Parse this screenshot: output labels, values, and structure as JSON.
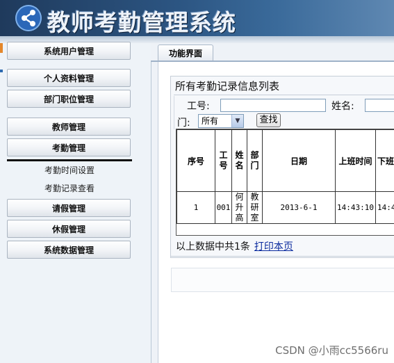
{
  "app": {
    "title": "教师考勤管理系统"
  },
  "sidebar": {
    "items": [
      {
        "label": "系统用户管理"
      },
      {
        "label": "个人资料管理"
      },
      {
        "label": "部门职位管理"
      },
      {
        "label": "教师管理"
      },
      {
        "label": "考勤管理"
      },
      {
        "label": "请假管理"
      },
      {
        "label": "休假管理"
      },
      {
        "label": "系统数据管理"
      }
    ],
    "submenu": [
      {
        "label": "考勤时间设置"
      },
      {
        "label": "考勤记录查看"
      }
    ]
  },
  "tabs": [
    {
      "label": "功能界面"
    }
  ],
  "panel": {
    "title": "所有考勤记录信息列表",
    "search": {
      "emp_no_label": "工号:",
      "name_label": "姓名:",
      "dept_label": "门:",
      "dept_selected": "所有",
      "find_button": "查找",
      "emp_no_value": "",
      "name_value": ""
    },
    "table": {
      "headers": [
        "序号",
        "工号",
        "姓名",
        "部门",
        "日期",
        "上班时间",
        "下班"
      ],
      "rows": [
        [
          "1",
          "001",
          "何升高",
          "教研室",
          "2013-6-1",
          "14:43:10",
          "14:4"
        ]
      ]
    },
    "footer": {
      "summary": "以上数据中共1条",
      "print_link": "打印本页"
    }
  },
  "watermark": "CSDN @小雨cc5566ru",
  "colors": {
    "header_dark": "#1f3a5c",
    "link": "#0a2a9e",
    "sidebar_bg": "#eef3f8"
  }
}
